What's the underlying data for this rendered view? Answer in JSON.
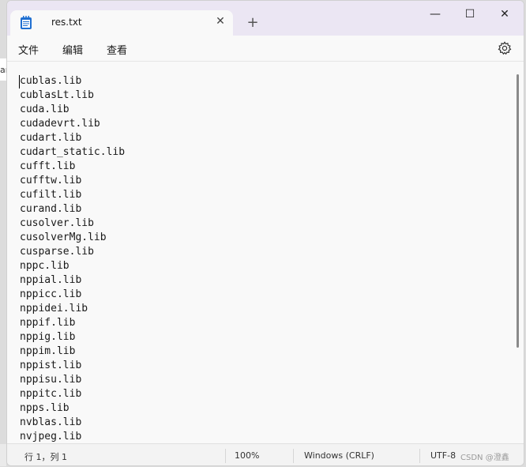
{
  "tab": {
    "title": "res.txt",
    "close_glyph": "✕"
  },
  "new_tab_glyph": "+",
  "window_controls": {
    "minimize": "—",
    "maximize": "☐",
    "close": "✕"
  },
  "menu": {
    "file": "文件",
    "edit": "编辑",
    "view": "查看"
  },
  "lines": [
    "cublas.lib",
    "cublasLt.lib",
    "cuda.lib",
    "cudadevrt.lib",
    "cudart.lib",
    "cudart_static.lib",
    "cufft.lib",
    "cufftw.lib",
    "cufilt.lib",
    "curand.lib",
    "cusolver.lib",
    "cusolverMg.lib",
    "cusparse.lib",
    "nppc.lib",
    "nppial.lib",
    "nppicc.lib",
    "nppidei.lib",
    "nppif.lib",
    "nppig.lib",
    "nppim.lib",
    "nppist.lib",
    "nppisu.lib",
    "nppitc.lib",
    "npps.lib",
    "nvblas.lib",
    "nvjpeg.lib"
  ],
  "status": {
    "position": "行 1，列 1",
    "zoom": "100%",
    "line_ending": "Windows (CRLF)",
    "encoding": "UTF-8",
    "watermark": "CSDN @澄鑫"
  },
  "icons": {
    "app": "notepad-icon",
    "settings": "gear-icon"
  },
  "colors": {
    "titlebar": "#ebe6f3",
    "app_icon": "#1f6fd1"
  }
}
